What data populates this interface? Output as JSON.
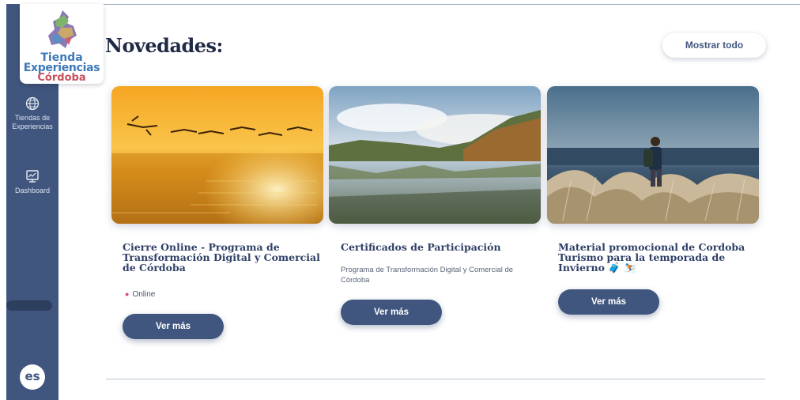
{
  "brand": {
    "line1": "Tienda",
    "line2": "Experiencias",
    "line3": "Córdoba",
    "icon": "sierras-logo-icon"
  },
  "sidebar": {
    "items": [
      {
        "label": "Tiendas de Experiencias",
        "icon": "globe-icon"
      },
      {
        "label": "Dashboard",
        "icon": "dashboard-monitor-icon"
      }
    ],
    "language": "es"
  },
  "header": {
    "title": "Novedades:",
    "show_all_label": "Mostrar todo"
  },
  "cards": [
    {
      "title": "Cierre Online - Programa de Transformación Digital y Comercial de Córdoba",
      "badge": "Online",
      "button_label": "Ver más",
      "image": "flamingos-sunset-lake"
    },
    {
      "title": "Certificados de Participación",
      "description": "Programa de Transformación Digital y Comercial de Córdoba",
      "button_label": "Ver más",
      "image": "river-landscape"
    },
    {
      "title": "Material promocional de Cordoba Turismo para la temporada de Invierno 🧳 ⛷️",
      "button_label": "Ver más",
      "image": "hiker-grassland-lake"
    }
  ],
  "colors": {
    "sidebar": "#40567e",
    "accent_pink": "#e0447a",
    "title": "#1f2a44"
  }
}
